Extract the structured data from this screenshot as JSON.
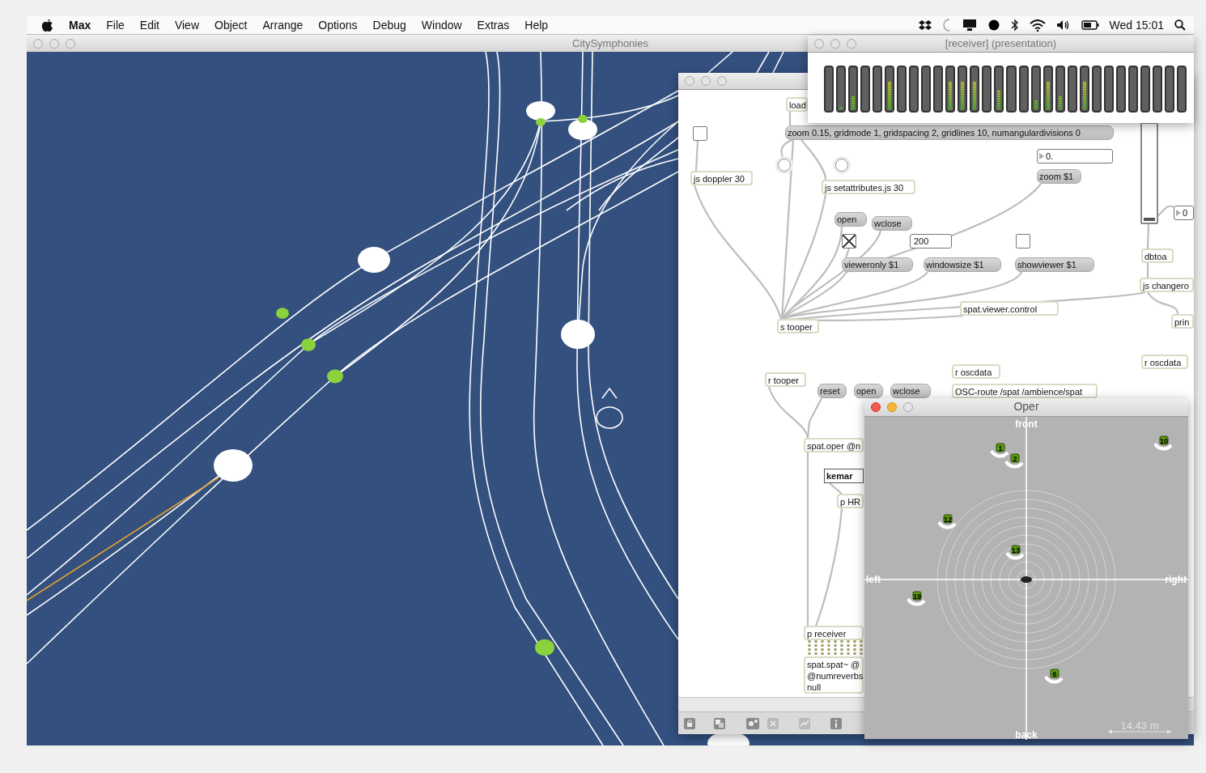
{
  "menu_bar": {
    "app": "Max",
    "items": [
      "File",
      "Edit",
      "View",
      "Object",
      "Arrange",
      "Options",
      "Debug",
      "Window",
      "Extras",
      "Help"
    ],
    "clock": "Wed 15:01"
  },
  "main_window": {
    "title": "CitySymphonies",
    "active": false
  },
  "patcher": {
    "active": false,
    "objects": [
      {
        "kind": "object",
        "text": "load"
      },
      {
        "kind": "toggle",
        "checked": false
      },
      {
        "kind": "message",
        "text": "zoom 0.15, gridmode 1, gridspacing 2, gridlines 10, numangulardivisions 0"
      },
      {
        "kind": "bang"
      },
      {
        "kind": "bang"
      },
      {
        "kind": "number",
        "text": "0."
      },
      {
        "kind": "message",
        "text": "zoom $1"
      },
      {
        "kind": "object",
        "text": "js doppler 30"
      },
      {
        "kind": "object",
        "text": "js setattributes.js 30"
      },
      {
        "kind": "message",
        "text": "open"
      },
      {
        "kind": "message",
        "text": "wclose"
      },
      {
        "kind": "toggle",
        "checked": true
      },
      {
        "kind": "int",
        "text": "200"
      },
      {
        "kind": "toggle",
        "checked": false
      },
      {
        "kind": "message",
        "text": "vieweronly $1"
      },
      {
        "kind": "message",
        "text": "windowsize $1"
      },
      {
        "kind": "message",
        "text": "showviewer $1"
      },
      {
        "kind": "object",
        "text": "spat.viewer.control"
      },
      {
        "kind": "object",
        "text": "s tooper"
      },
      {
        "kind": "slider"
      },
      {
        "kind": "number",
        "text": "0"
      },
      {
        "kind": "object",
        "text": "dbtoa"
      },
      {
        "kind": "object",
        "text": "js changero"
      },
      {
        "kind": "object",
        "text": "prin"
      },
      {
        "kind": "object",
        "text": "r oscdata"
      },
      {
        "kind": "object",
        "text": "r oscdata"
      },
      {
        "kind": "object",
        "text": "r tooper"
      },
      {
        "kind": "message",
        "text": "reset"
      },
      {
        "kind": "message",
        "text": "open"
      },
      {
        "kind": "message",
        "text": "wclose"
      },
      {
        "kind": "object",
        "text": "OSC-route /spat /ambience/spat"
      },
      {
        "kind": "object",
        "text": "spat.oper @n"
      },
      {
        "kind": "menu",
        "text": "kemar"
      },
      {
        "kind": "object",
        "text": "p HR"
      },
      {
        "kind": "object",
        "text": "p receiver"
      },
      {
        "kind": "object",
        "text": "spat.spat~ @\n@numreverbs\nnull"
      }
    ]
  },
  "receiver_window": {
    "title": "[receiver] (presentation)",
    "active": false,
    "meters": [
      {
        "level": 0
      },
      {
        "level": 0.05
      },
      {
        "level": 0.3
      },
      {
        "level": 0
      },
      {
        "level": 0
      },
      {
        "level": 0.65
      },
      {
        "level": 0
      },
      {
        "level": 0
      },
      {
        "level": 0
      },
      {
        "level": 0
      },
      {
        "level": 0.65
      },
      {
        "level": 0.65
      },
      {
        "level": 0.65
      },
      {
        "level": 0
      },
      {
        "level": 0.45
      },
      {
        "level": 0
      },
      {
        "level": 0
      },
      {
        "level": 0.2
      },
      {
        "level": 0.65
      },
      {
        "level": 0.3
      },
      {
        "level": 0
      },
      {
        "level": 0.65
      },
      {
        "level": 0
      },
      {
        "level": 0
      },
      {
        "level": 0
      },
      {
        "level": 0
      },
      {
        "level": 0
      },
      {
        "level": 0
      },
      {
        "level": 0
      },
      {
        "level": 0
      }
    ]
  },
  "oper_window": {
    "title": "Oper",
    "active": true,
    "front": "front",
    "back": "back",
    "left": "left",
    "right": "right",
    "scale": "14.43 m",
    "sources": [
      {
        "label": "1"
      },
      {
        "label": "2"
      },
      {
        "label": "10"
      },
      {
        "label": "12"
      },
      {
        "label": "13"
      },
      {
        "label": "19"
      },
      {
        "label": "6"
      }
    ]
  }
}
